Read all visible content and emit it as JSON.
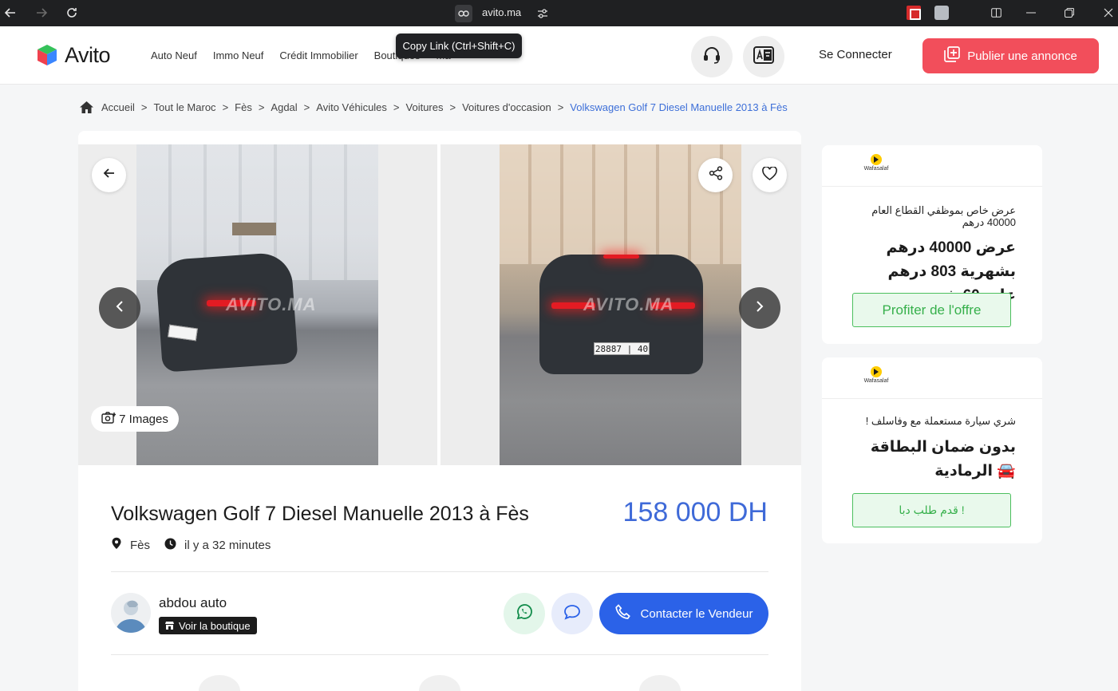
{
  "browser": {
    "url": "avito.ma",
    "tooltip": "Copy Link (Ctrl+Shift+C)"
  },
  "header": {
    "logo_text": "Avito",
    "nav": [
      "Auto Neuf",
      "Immo Neuf",
      "Crédit Immobilier",
      "Boutiques",
      "Ma"
    ],
    "connect_label": "Se Connecter",
    "publish_label": "Publier une annonce",
    "accent_color": "#f24e5b"
  },
  "breadcrumb": {
    "items": [
      "Accueil",
      "Tout le Maroc",
      "Fès",
      "Agdal",
      "Avito Véhicules",
      "Voitures",
      "Voitures d'occasion"
    ],
    "current": "Volkswagen Golf 7 Diesel Manuelle 2013 à Fès",
    "separator": ">"
  },
  "gallery": {
    "image_count_label": "7 Images",
    "watermark": "AVITO.MA",
    "plate1": "28887 | 40",
    "plate2": "28887 | 40"
  },
  "listing": {
    "title": "Volkswagen Golf 7 Diesel Manuelle 2013 à Fès",
    "price": "158 000 DH",
    "location": "Fès",
    "posted": "il y a 32 minutes"
  },
  "seller": {
    "name": "abdou auto",
    "shop_label": "Voir la boutique",
    "contact_label": "Contacter le Vendeur"
  },
  "ads": [
    {
      "brand": "Wafasalaf",
      "small": "عرض خاص بموظفي القطاع العام 40000 درهم",
      "big": "عرض 40000 درهم بشهرية 803 درهم على 60 شهر",
      "cta": "Profiter de l'offre"
    },
    {
      "brand": "Wafasalaf",
      "small": "شري سيارة مستعملة مع وفاسلف !",
      "big": "بدون ضمان البطاقة 🚘 الرمادية",
      "cta": "قدم طلب دبا !"
    }
  ]
}
